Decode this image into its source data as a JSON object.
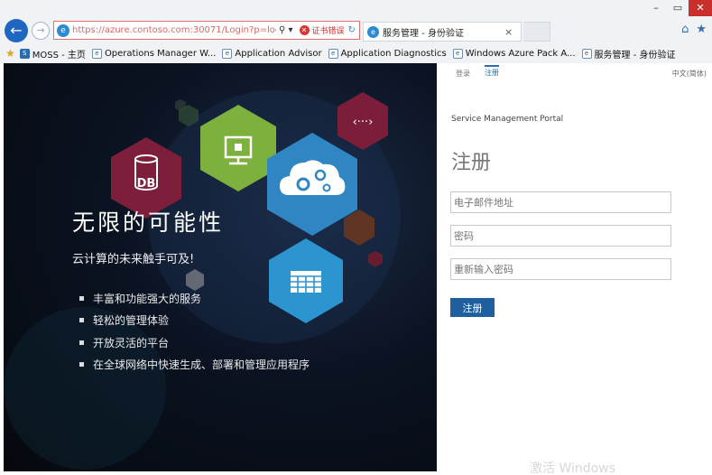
{
  "window": {
    "minimize": "–",
    "restore": "▭",
    "close": "✕"
  },
  "browser": {
    "back_icon": "←",
    "forward_icon": "→",
    "url": "https://azure.contoso.com:30071/Login?p=login",
    "search_icon": "⚲ ▾",
    "cert_error_icon": "✕",
    "cert_error": "证书错误",
    "refresh_icon": "↻",
    "tab_title": "服务管理 - 身份验证",
    "tab_close": "×",
    "home_icon": "⌂",
    "fav_icon": "★"
  },
  "favorites": {
    "star": "★",
    "items": [
      {
        "label": "MOSS - 主页",
        "icon": "S"
      },
      {
        "label": "Operations Manager W...",
        "icon": "e"
      },
      {
        "label": "Application Advisor",
        "icon": "e"
      },
      {
        "label": "Application Diagnostics",
        "icon": "e"
      },
      {
        "label": "Windows Azure Pack A...",
        "icon": "e"
      },
      {
        "label": "服务管理 - 身份验证",
        "icon": "e"
      }
    ]
  },
  "hero": {
    "title": "无限的可能性",
    "subtitle": "云计算的未来触手可及!",
    "bullets": [
      "丰富和功能强大的服务",
      "轻松的管理体验",
      "开放灵活的平台",
      "在全球网络中快速生成、部署和管理应用程序"
    ],
    "icons": {
      "db_label": "DB",
      "code_label": "‹···›"
    },
    "colors": {
      "db": "#7d1e3a",
      "monitor": "#7db13d",
      "cloud": "#2f86c2",
      "grid": "#2c95cf",
      "code": "#7c1d3a"
    }
  },
  "form": {
    "tabs": [
      "登录",
      "注册"
    ],
    "active_tab": 1,
    "language": "中文(简体)",
    "portal_name": "Service Management Portal",
    "heading": "注册",
    "email_placeholder": "电子邮件地址",
    "password_placeholder": "密码",
    "confirm_placeholder": "重新输入密码",
    "submit_label": "注册",
    "accent": "#1f5f9e"
  },
  "watermark": "激活 Windows"
}
